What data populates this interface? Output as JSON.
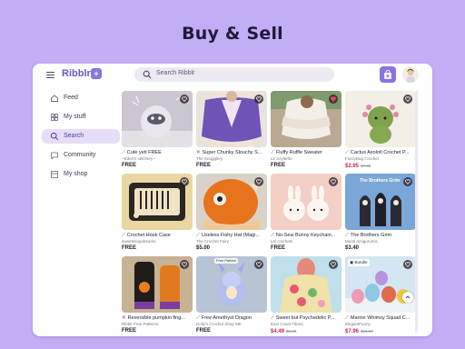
{
  "headline": "Buy & Sell",
  "app": {
    "brand": "Ribblr",
    "search_placeholder": "Search Ribblr"
  },
  "sidebar": {
    "items": [
      {
        "label": "Feed",
        "icon": "home-icon",
        "active": false
      },
      {
        "label": "My stuff",
        "icon": "grid-icon",
        "active": false
      },
      {
        "label": "Search",
        "icon": "search-icon",
        "active": true
      },
      {
        "label": "Community",
        "icon": "chat-icon",
        "active": false
      },
      {
        "label": "My shop",
        "icon": "shop-icon",
        "active": false
      }
    ]
  },
  "products": [
    {
      "title": "Cute yeti FREE",
      "seller": "~Eden's stitchery~",
      "price": "FREE",
      "was": "",
      "tool": "crochet-hook-icon",
      "liked": false,
      "bg": "#c9c4d0"
    },
    {
      "title": "Super Chunky Slouchy S...",
      "seller": "The Snugglery",
      "price": "FREE",
      "was": "",
      "tool": "knitting-needles-icon",
      "liked": false,
      "bg": "#e8e2da"
    },
    {
      "title": "Fluffy Ruffle Sweater",
      "seller": "Le Szyltefto",
      "price": "FREE",
      "was": "",
      "tool": "crochet-hook-icon",
      "liked": true,
      "bg": "#c8b8a4"
    },
    {
      "title": "Cactus Axolotl Crochet P...",
      "seller": "FuzzyBug Crochet",
      "price": "$2.95",
      "was": "$7.38",
      "tool": "crochet-hook-icon",
      "liked": false,
      "bg": "#f1ece2"
    },
    {
      "title": "Crochet Hook Case",
      "seller": "sweetkloqudreams",
      "price": "FREE",
      "was": "",
      "tool": "crochet-hook-icon",
      "liked": false,
      "bg": "#ecd9a6"
    },
    {
      "title": "Useless Fishy Hat (Magi...",
      "seller": "The Crochet Fairy",
      "price": "$5.00",
      "was": "",
      "tool": "crochet-hook-icon",
      "liked": false,
      "bg": "#e9751f"
    },
    {
      "title": "No-Sew Bunny Keychain...",
      "seller": "Lel crochets",
      "price": "FREE",
      "was": "",
      "tool": "crochet-hook-icon",
      "liked": false,
      "bg": "#f3c9c1"
    },
    {
      "title": "The Brothers Grim",
      "seller": "Mooti Amigurumis",
      "price": "$3.40",
      "was": "",
      "tool": "crochet-hook-icon",
      "liked": false,
      "bg": "#7fa7d6"
    },
    {
      "title": "Reversible pumpkin fing...",
      "seller": "Ribblr Free Patterns",
      "price": "FREE",
      "was": "",
      "tool": "knitting-needles-icon",
      "liked": false,
      "bg": "#c9b59a"
    },
    {
      "title": "Free Amethyst Dragon",
      "seller": "Dolly's Crochet Shop MK",
      "price": "FREE",
      "was": "",
      "tool": "crochet-hook-icon",
      "liked": false,
      "bg": "#b9c7d6"
    },
    {
      "title": "Sweet but Psychedelic P...",
      "seller": "East Coast Fibres",
      "price": "$4.49",
      "was": "$5.99",
      "tool": "crochet-hook-icon",
      "liked": false,
      "bg": "#bfe0ea"
    },
    {
      "title": "Marine Whimsy Squad C...",
      "seller": "ElegantFunny",
      "price": "$7.96",
      "was": "$15.92",
      "tool": "crochet-hook-icon",
      "liked": false,
      "bg": "#cfe3f1"
    }
  ],
  "tags": {
    "bundle": "Bundle",
    "free_pattern_flag": "Free Pattern",
    "brothers_banner": "The Brothers Grim"
  },
  "colors": {
    "background": "#c2aef5",
    "accent": "#8a74e0",
    "sale_price": "#c9245b",
    "liked_heart": "#e8456b"
  }
}
